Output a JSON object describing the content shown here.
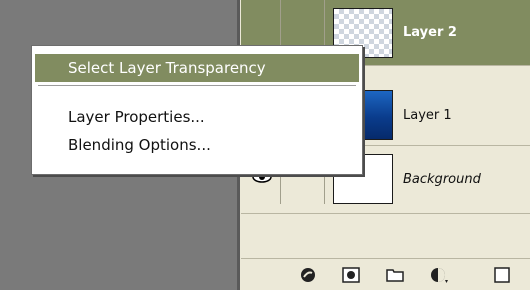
{
  "layers_panel": {
    "layers": [
      {
        "name": "Layer 2",
        "thumbnail": "transparent-checker",
        "selected": true
      },
      {
        "name": "Layer 1",
        "thumbnail": "blue-gradient",
        "selected": false
      },
      {
        "name": "Background",
        "thumbnail": "white",
        "selected": false,
        "visible_eye": true
      }
    ],
    "toolbar_icons": [
      "link-layers-icon",
      "add-layer-mask-icon",
      "new-group-icon",
      "adjustment-layer-icon",
      "new-layer-icon"
    ]
  },
  "context_menu": {
    "items": [
      {
        "label": "Select Layer Transparency",
        "highlighted": true
      },
      {
        "label": "Layer Properties..."
      },
      {
        "label": "Blending Options..."
      }
    ]
  },
  "colors": {
    "selection": "#818c60",
    "panel_bg": "#ece9d8",
    "canvas_bg": "#7a7a7a"
  }
}
